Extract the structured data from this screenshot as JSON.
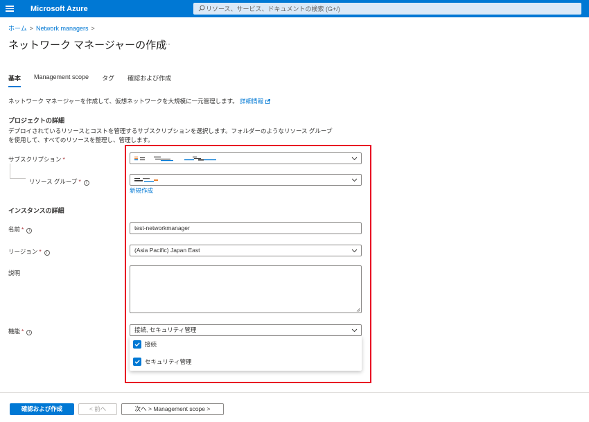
{
  "header": {
    "brand": "Microsoft Azure",
    "search_placeholder": "リソース、サービス、ドキュメントの検索 (G+/)"
  },
  "breadcrumb": {
    "home": "ホーム",
    "network_managers": "Network managers"
  },
  "page": {
    "title": "ネットワーク マネージャーの作成",
    "more": "···"
  },
  "tabs": [
    {
      "label": "基本",
      "active": true
    },
    {
      "label": "Management scope",
      "active": false
    },
    {
      "label": "タグ",
      "active": false
    },
    {
      "label": "確認および作成",
      "active": false
    }
  ],
  "intro": {
    "text": "ネットワーク マネージャーを作成して、仮想ネットワークを大規模に一元管理します。",
    "link": "詳細情報"
  },
  "project": {
    "title": "プロジェクトの詳細",
    "desc_line1": "デプロイされているリソースとコストを管理するサブスクリプションを選択します。フォルダーのようなリソース グループ",
    "desc_line2": "を使用して、すべてのリソースを整理し、管理します。",
    "subscription_label": "サブスクリプション",
    "resource_group_label": "リソース グループ",
    "new_link": "新規作成"
  },
  "instance": {
    "title": "インスタンスの詳細",
    "name_label": "名前",
    "name_value": "test-networkmanager",
    "region_label": "リージョン",
    "region_value": "(Asia Pacific) Japan East",
    "desc_label": "説明",
    "features_label": "機能",
    "features_value": "接続, セキュリティ管理",
    "options": [
      {
        "label": "接続",
        "checked": true
      },
      {
        "label": "セキュリティ管理",
        "checked": true
      }
    ]
  },
  "footer": {
    "review_create": "確認および作成",
    "prev": "< 前へ",
    "next": "次へ > Management scope >"
  },
  "colors": {
    "accent": "#0078d4",
    "highlight": "#e81123",
    "required": "#a4262c"
  }
}
